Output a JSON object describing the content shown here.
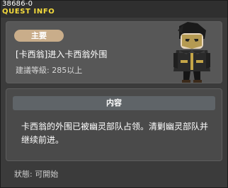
{
  "window": {
    "id": "38686-0",
    "title": "QUEST INFO"
  },
  "quest": {
    "badge": "主要",
    "name": "[卡西翁]进入卡西翁外围",
    "requirement": "建議等級: 285以上"
  },
  "content": {
    "header": "内容",
    "description": "卡西翁的外围已被幽灵部队占领。清剿幽灵部队并\n继续前进。"
  },
  "status": "狀態:  可開始",
  "colors": {
    "title": "#f6dc3c",
    "badge": "#c9ad8a",
    "panel": "#575757"
  }
}
